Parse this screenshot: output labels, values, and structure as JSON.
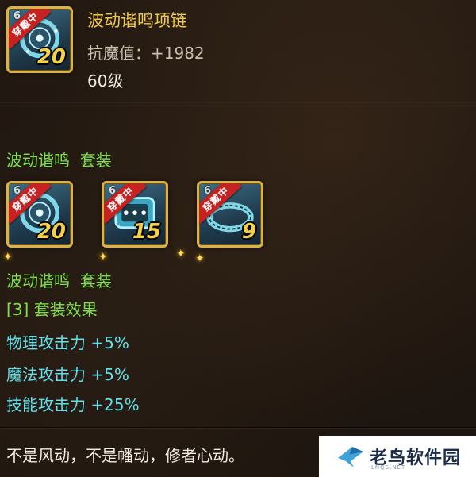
{
  "header": {
    "item_name": "波动谐鸣项链",
    "resist_label": "抗魔值：",
    "resist_value": "+1982",
    "level_text": "60级"
  },
  "main_icon": {
    "level": "20",
    "badge": "穿戴中",
    "tag": "6"
  },
  "set": {
    "title_top": "波动谐鸣  套装",
    "title_bottom": "波动谐鸣  套装",
    "pieces": [
      {
        "level": "20",
        "badge": "穿戴中",
        "tag": "6",
        "icon": "necklace-icon"
      },
      {
        "level": "15",
        "badge": "穿戴中",
        "tag": "6",
        "icon": "bracelet-icon"
      },
      {
        "level": "9",
        "badge": "穿戴中",
        "tag": "6",
        "icon": "ring-icon"
      }
    ],
    "effect_title": "[3] 套装效果",
    "effects": [
      "物理攻击力 +5%",
      "魔法攻击力 +5%",
      "技能攻击力 +25%"
    ]
  },
  "flavor_text": "不是风动，不是幡动，修者心动。",
  "watermark": {
    "name": "老鸟软件园",
    "sub": "LNQS.NET"
  },
  "colors": {
    "title_gold": "#f0c84a",
    "set_green": "#7ee04a",
    "effect_cyan": "#5fe0ea",
    "badge_red": "#c62222"
  }
}
